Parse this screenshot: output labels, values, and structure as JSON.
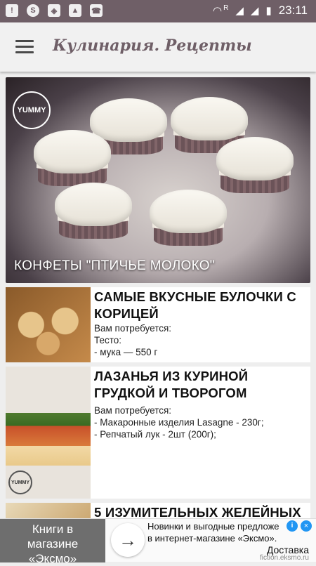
{
  "status_bar": {
    "time": "23:11",
    "network_letter": "R",
    "icons": [
      "alert-icon",
      "sync-icon",
      "shield-icon",
      "image-icon",
      "phone-icon",
      "wifi-icon",
      "signal-icon",
      "signal-icon",
      "battery-icon"
    ]
  },
  "app_bar": {
    "title": "Кулинария. Рецепты",
    "menu_icon": "hamburger-icon"
  },
  "featured": {
    "logo_text": "YUMMY",
    "title": "КОНФЕТЫ \"ПТИЧЬЕ МОЛОКО\""
  },
  "recipes": [
    {
      "title": "САМЫЕ ВКУСНЫЕ БУЛОЧКИ С КОРИЦЕЙ",
      "lines": [
        "Вам потребуется:",
        "Тесто:",
        "- мука — 550 г"
      ]
    },
    {
      "title": "ЛАЗАНЬЯ ИЗ КУРИНОЙ ГРУДКОЙ И ТВОРОГОМ",
      "lines": [
        "Вам потребуется:",
        "- Макаронные изделия Lasagne - 230г;",
        "- Репчатый лук - 2шт (200г);"
      ],
      "logo_text": "YUMMY"
    },
    {
      "title": "5 ИЗУМИТЕЛЬНЫХ ЖЕЛЕЙНЫХ"
    }
  ],
  "ad": {
    "left_text_1": "Книги в",
    "left_text_2": "магазине",
    "left_text_3": "«Эксмо»",
    "text_1": "Новинки и выгодные предложе",
    "text_2": "в интернет-магазине «Эксмо».",
    "cta": "Доставка",
    "domain": "fiction.eksmo.ru",
    "arrow_icon": "arrow-right-icon",
    "info_icon": "info-icon",
    "close_icon": "close-icon"
  }
}
